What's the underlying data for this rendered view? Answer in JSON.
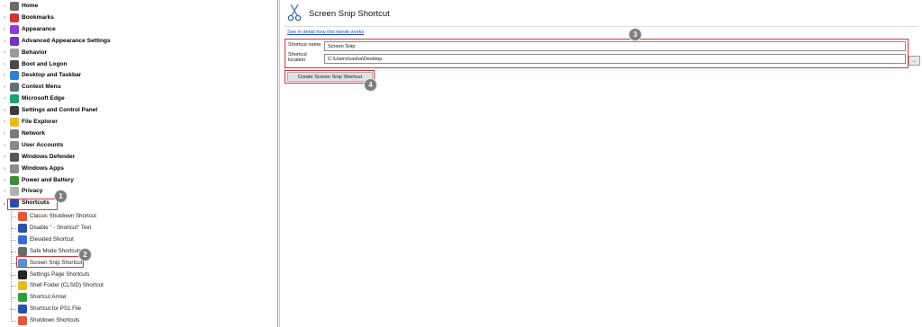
{
  "tree": {
    "top_items": [
      {
        "label": "Home",
        "icon": "home-icon",
        "color": "#6b6b6b"
      },
      {
        "label": "Bookmarks",
        "icon": "bookmark-icon",
        "color": "#d13438"
      },
      {
        "label": "Appearance",
        "icon": "palette-icon",
        "color": "#8e3ad6"
      },
      {
        "label": "Advanced Appearance Settings",
        "icon": "palette-icon",
        "color": "#7a2ec0"
      },
      {
        "label": "Behavior",
        "icon": "behavior-icon",
        "color": "#9b9b9b"
      },
      {
        "label": "Boot and Logon",
        "icon": "boot-icon",
        "color": "#4a4a4a"
      },
      {
        "label": "Desktop and Taskbar",
        "icon": "desktop-icon",
        "color": "#2f7fd1"
      },
      {
        "label": "Context Menu",
        "icon": "menu-icon",
        "color": "#5f6f7f"
      },
      {
        "label": "Microsoft Edge",
        "icon": "edge-icon",
        "color": "#1aa36a"
      },
      {
        "label": "Settings and Control Panel",
        "icon": "gear-icon",
        "color": "#3a3a3a"
      },
      {
        "label": "File Explorer",
        "icon": "folder-icon",
        "color": "#e8b923"
      },
      {
        "label": "Network",
        "icon": "network-icon",
        "color": "#7a7a7a"
      },
      {
        "label": "User Accounts",
        "icon": "user-icon",
        "color": "#888888"
      },
      {
        "label": "Windows Defender",
        "icon": "shield-icon",
        "color": "#555555"
      },
      {
        "label": "Windows Apps",
        "icon": "apps-icon",
        "color": "#8a8a8a"
      },
      {
        "label": "Power and Battery",
        "icon": "battery-icon",
        "color": "#3c8c3c"
      },
      {
        "label": "Privacy",
        "icon": "privacy-icon",
        "color": "#b0b0b0"
      },
      {
        "label": "Shortcuts",
        "icon": "shortcut-icon",
        "color": "#2b4fa8"
      }
    ],
    "child_items": [
      {
        "label": "Classic Shutdown Shortcut",
        "icon": "shutdown-icon",
        "color": "#e0573a"
      },
      {
        "label": "Disable \" - Shortcut\" Text",
        "icon": "shortcut-icon",
        "color": "#2b4fa8"
      },
      {
        "label": "Elevated Shortcut",
        "icon": "shield-icon",
        "color": "#3a6fd1"
      },
      {
        "label": "Safe Mode Shortcuts",
        "icon": "safe-mode-icon",
        "color": "#6b6b6b"
      },
      {
        "label": "Screen Snip Shortcut",
        "icon": "scissors-icon",
        "color": "#5a8fd1"
      },
      {
        "label": "Settings Page Shortcuts",
        "icon": "gear-icon",
        "color": "#222222"
      },
      {
        "label": "Shell Folder (CLSID) Shortcut",
        "icon": "folder-icon",
        "color": "#e8b923"
      },
      {
        "label": "Shortcut Arrow",
        "icon": "arrow-icon",
        "color": "#2e9b3a"
      },
      {
        "label": "Shortcut for PS1 File",
        "icon": "powershell-icon",
        "color": "#2b4fa8"
      },
      {
        "label": "Shutdown Shortcuts",
        "icon": "shutdown-icon",
        "color": "#e0573a"
      }
    ]
  },
  "badges": {
    "b1": "1",
    "b2": "2",
    "b3": "3",
    "b4": "4"
  },
  "panel": {
    "title": "Screen Snip Shortcut",
    "header_icon": "scissors-icon",
    "detail_link": "See in detail how this tweak works",
    "shortcut_name_label": "Shortcut name",
    "shortcut_name_value": "Screen Snip",
    "shortcut_location_label_1": "Shortcut",
    "shortcut_location_label_2": "location",
    "shortcut_location_value": "C:\\Users\\vasha\\Desktop",
    "browse_label": "...",
    "create_button": "Create Screen Snip Shortcut"
  },
  "colors": {
    "highlight": "#d6323c",
    "badge": "#7d7d7d",
    "link": "#1a4bd6"
  }
}
